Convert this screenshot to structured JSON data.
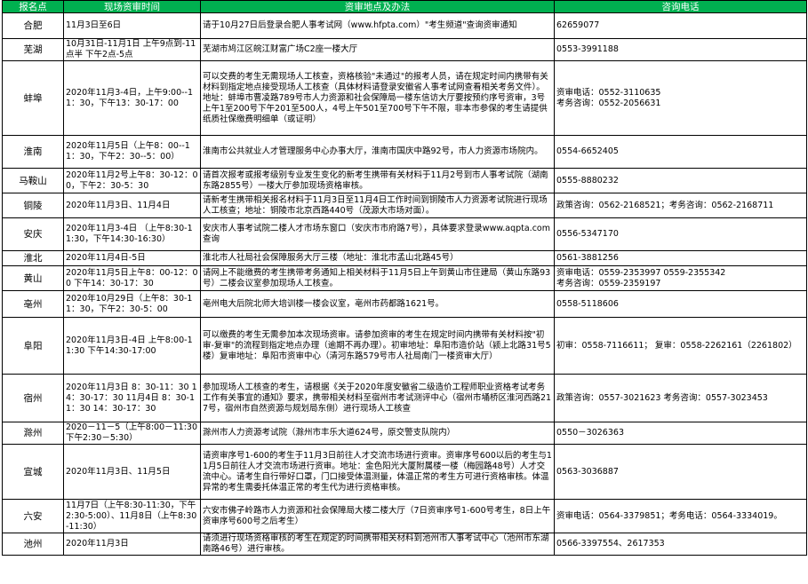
{
  "table": {
    "headers": [
      "报名点",
      "现场资审时间",
      "资审地点及办法",
      "咨询电话"
    ],
    "rows": [
      {
        "city": "合肥",
        "time": "11月3日至6日",
        "place": "请于10月27日后登录合肥人事考试网（www.hfpta.com）\"考生频道\"查询资审通知",
        "phone": "62659077"
      },
      {
        "city": "芜湖",
        "time": "10月31日-11月1日 上午9点到-11点半 下午2点-5点",
        "place": "芜湖市鸠江区皖江财富广场C2座一楼大厅",
        "phone": "0553-3991188"
      },
      {
        "city": "蚌埠",
        "time": "2020年11月3-4日，上午9:00--11：30，下午13：30-17：00",
        "place": "可以交费的考生无需现场人工核查，资格核验\"未通过\"的报考人员，请在规定时间内携带有关材料到指定地点接受现场人工核查（具体材料请登录安徽省人事考试网查看相关考务文件）。地址：蚌埠市曹凌路789号市人力资源和社会保障局一楼东信访大厅要按预约序号资审，3号上午1至200号下午201至500人，4号上午501至700号下午不限，非本市参保的考生请提供纸质社保缴费明细单（或证明）",
        "phone": "资审电话：0552-3110635\n考务咨询：0552-2056631"
      },
      {
        "city": "淮南",
        "time": "2020年11月5日（上午8：00--11：30，下午2：30--5：00）",
        "place": "淮南市公共就业人才管理服务中心办事大厅，淮南市国庆中路92号，市人力资源市场院内。",
        "phone": "0554-6652405"
      },
      {
        "city": "马鞍山",
        "time": "2020年11月2号上午8：30-12：00，下午2：30-5：30",
        "place": "请首次报考或报考级别专业发生变化的新考生携带有关材料于11月2号到市人事考试院（湖南东路2855号）一楼大厅参加现场资格审核。",
        "phone": "0555-8880232"
      },
      {
        "city": "铜陵",
        "time": "2020年11月3日、11月4日",
        "place": "请新考生携带相关报名材料于11月3日至11月4日工作时间到铜陵市人力资源考试院进行现场人工核查；地址：铜陵市北京西路440号（茂源大市场对面）。",
        "phone": "政策咨询：0562-2168521；考务咨询：0562-2168711"
      },
      {
        "city": "安庆",
        "time": "2020年11月3-4日 （上午8:30-11:30，下午14:30-16:30）",
        "place": "安庆市人事考试院二楼人才市场东窗口（安庆市市府路7号），具体要求登录www.aqpta.com查询",
        "phone": "0556-5347170"
      },
      {
        "city": "淮北",
        "time": "2020年11月4日-5日",
        "place": "淮北市人社局社会保障服务大厅三楼（地址：淮北市孟山北路45号）",
        "phone": "0561-3881256"
      },
      {
        "city": "黄山",
        "time": "2020年11月5日上午8：00-12：00 下午14：30-17：30",
        "place": "请网上不能缴费的考生携带考务通知上相关材料于11月5日上午到黄山市住建局（黄山东路93号）二楼会议室参加现场人工核查。",
        "phone": "资审电话：0559-2353997 0559-2355342\n考务咨询：0559-2359197"
      },
      {
        "city": "亳州",
        "time": "2020年10月29日（上午8：30-11：30，下午2：30-5：00",
        "place": "亳州电大后院北师大培训楼一楼会议室，亳州市药都路1621号。",
        "phone": "0558-5118606"
      },
      {
        "city": "阜阳",
        "time": "2020年11月3日-4日 上午8:00-11:30 下午14:30-17:00",
        "place": "可以缴费的考生无需参加本次现场资审。请参加资审的考生在规定时间内携带有关材料按\"初审-复审\"的流程到指定地点办理（逾期不再办理）。初审地址：阜阳市造价站（颍上北路31号5楼）复审地址：阜阳市资审中心（清河东路579号市人社局南门一楼资审大厅）",
        "phone": "初审：0558-7116611； 复审：0558-2262161（2261802）"
      },
      {
        "city": "宿州",
        "time": "2020年11月3日 8：30-11：30 14：30-17：30 11月4日 8：30-11：30 14：30-17：30",
        "place": "参加现场人工核查的考生，请根据《关于2020年度安徽省二级造价工程师职业资格考试考务工作有关事宜的通知》要求，携带相关材料至宿州市考试测评中心（宿州市埇桥区淮河西路217号，宿州市自然资源与规划局东侧）进行现场人工核查",
        "phone": "政策咨询：0557-3021623 考务咨询：0557-3023453"
      },
      {
        "city": "滁州",
        "time": "2020－11－5（上午8:00－11:30 下午2:30－5:30）",
        "place": "滁州市人力资源考试院（滁州市丰乐大道624号，原交警支队院内）",
        "phone": "0550－3026363"
      },
      {
        "city": "宣城",
        "time": "2020年11月3日、11月5日",
        "place": "请资审序号1-600的考生于11月3日前往人才交流市场进行资审。资审序号600以后的考生与11月5日前往人才交流市场进行资审。地址：金色阳光大厦附属楼一楼（梅园路48号）人才交流中心。请考生自行带好口罩，门口接受体温测量，体温正常的考生方可进行资格审核。体温异常的考生需委托体温正常的考生代为进行资格审核。",
        "phone": "0563-3036887"
      },
      {
        "city": "六安",
        "time": "11月7日（上午8:30-11:30，下午2:30-5:00）、11月8日（上午8:30-11:30）",
        "place": "六安市佛子岭路市人力资源和社会保障局大楼二楼大厅（7日资审序号1-600号考生，8日上午资审序号600号之后考生）",
        "phone": "资审电话：0564-3379851；考务电话：0564-3334019。"
      },
      {
        "city": "池州",
        "time": "2020年11月3日",
        "place": "请须进行现场资格审核的考生在规定的时间携带相关材料到池州市人事考试中心（池州市东湖南路46号）进行审核。",
        "phone": "0566-3397554、2617353"
      }
    ]
  },
  "colors": {
    "header_bg": "#00b050",
    "header_text": "#ffffff",
    "border": "#000000"
  }
}
